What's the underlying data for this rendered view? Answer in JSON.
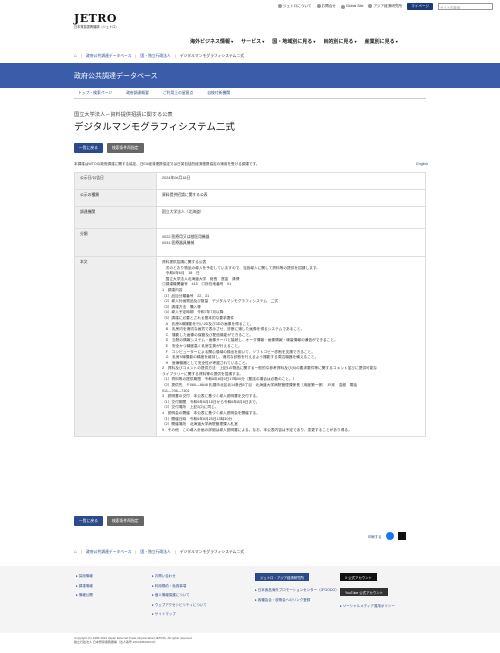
{
  "header": {
    "util": [
      "ジェトロについて",
      "お問合せ",
      "Global Site",
      "アジア経済研究所"
    ],
    "mypage": "マイページ",
    "search_placeholder": "サイト内検索",
    "logo": "JETRO",
    "logo_sub": "日本貿易振興機構（ジェトロ）",
    "nav": [
      "海外ビジネス情報",
      "サービス",
      "国・地域別に見る",
      "目的別に見る",
      "産業別に見る"
    ]
  },
  "breadcrumb": [
    "政府公共調達データベース",
    "国・独立行政法人",
    "デジタルマンモグラフィシステム二式"
  ],
  "band_title": "政府公共調達データベース",
  "subnav": [
    "トップ・検索ページ",
    "政府調達概要",
    "ご利用上の留意点",
    "自検付新機関"
  ],
  "pretitle": "国立大学法人－資料提供招請に関する公表",
  "title": "デジタルマンモグラフィシステム二式",
  "buttons": {
    "back": "一覧に戻る",
    "research": "検索条件再指定"
  },
  "note": "本調達はWTOの政府調達に関する協定、日EU経済連携協定又は日英包括的経済連携協定の適用を受ける調達です。",
  "english": "English",
  "rows": [
    {
      "th": "公示日/公告日",
      "td": "2024年06月18日"
    },
    {
      "th": "公示の種類",
      "td": "資料提供招請に関する公表"
    },
    {
      "th": "調達機関",
      "td": "国立大学法人（北海道）"
    },
    {
      "th": "分類",
      "td": "0022 医療用又は獣医用機器\n0031 医療器具機械"
    }
  ],
  "body_label": "本文",
  "body": [
    "資料提供招請に関する公表",
    "　次のとおり物品の導入を予定していますので、当該導入に関して資料等の提供を招請します。",
    "　令和6年6月　18　日",
    "　国立大学法人北海道大学　総長　寳金　清博",
    "◎調達機関番号　415　◎所在地番号　01",
    "1　調達内容",
    "（1）品目分類番号　22、31",
    "（2）導入計画物品及び数量　デジタルマンモグラフィシステム　二式",
    "（3）調達方法　購入等",
    "（4）導入予定時期　令和7年7月以降",
    "（5）調達に必要とされる基本的な要求要件",
    "　A　乳房X線撮影を行い2D及び3Dの画像を得ること。",
    "　B　乳房内を適切な画質で表示させ、診断に適した画像を得るシステムであること。",
    "　C　撮影した画像の保管及び配信機能ができること。",
    "　D　当院の情報システム・画像サーバと接続し、オーダ情報・画像情報・線量情報の通信ができること。",
    "　E　安全かつ精度高く乳房生検が行えること。",
    "　F　コンピューターによる関心領域の検出を用いて、ソフトコピー診断を支援できること。",
    "　G　乳房X線撮影の精度を維持し、適切な診断を行えるよう撮影する周辺機器を備えること。",
    "　H　医療機器として安全性が考慮されていること。",
    "2　資料及びコメントの提供方法　上記1の物品に関する一般的な参考資料及び(5)の要求要件等に関するコメント並びに提供可能な",
    "ライブラリーに関する資料等の提供を招請する。",
    "（1）資料等の提供期限　令和6年8月5日17時00分（郵送の場合は必着のこと。）",
    "（2）提供先　〒060―8648 札幌市北区北14条西5丁目　北海道大学病院管理課係長（用度第一係）　戸來　浩樹　電話",
    "011―706―7401",
    "3　説明書の交付　本公表に基づく導入説明書を交付する。",
    "（1）交付期間　令和6年6月18日から令和6年8月5日まで。",
    "（2）交付場所　上記2(2)に同じ。",
    "4　説明会の開催　本公表に基づく導入説明会を開催する。",
    "（1）開催日時　令和6年6月25日13時30分",
    "（2）開催場所　北海道大学病院管理課入札室",
    "5　その他　この導入計画の詳細は導入説明書による。なお、本公表内容は予定であり、変更することがあり得る。"
  ],
  "share": {
    "print": "印刷する"
  },
  "footer": {
    "col1": [
      "採用情報",
      "調達情報",
      "情報公開"
    ],
    "col2": [
      "お問い合わせ",
      "利用規約・免責事項",
      "個人情報保護について",
      "ウェブアクセシビリティについて",
      "サイトマップ"
    ],
    "col3": [
      "ジェトロ・アジア経済研究所",
      "日本食品海外プロモーションセンター（JFOODO）",
      "各種会合・説明会へのリンク登録"
    ],
    "col4": [
      "X 公式アカウント",
      "YouTube 公式アカウント",
      "ソーシャルメディア運用ポリシー"
    ]
  },
  "copyright": "Copyright (C) 1995-2024 Japan External Trade Organization(JETRO). All rights reserved.",
  "address": "独立行政法人 日本貿易振興機構（法人番号 2010405002043）"
}
